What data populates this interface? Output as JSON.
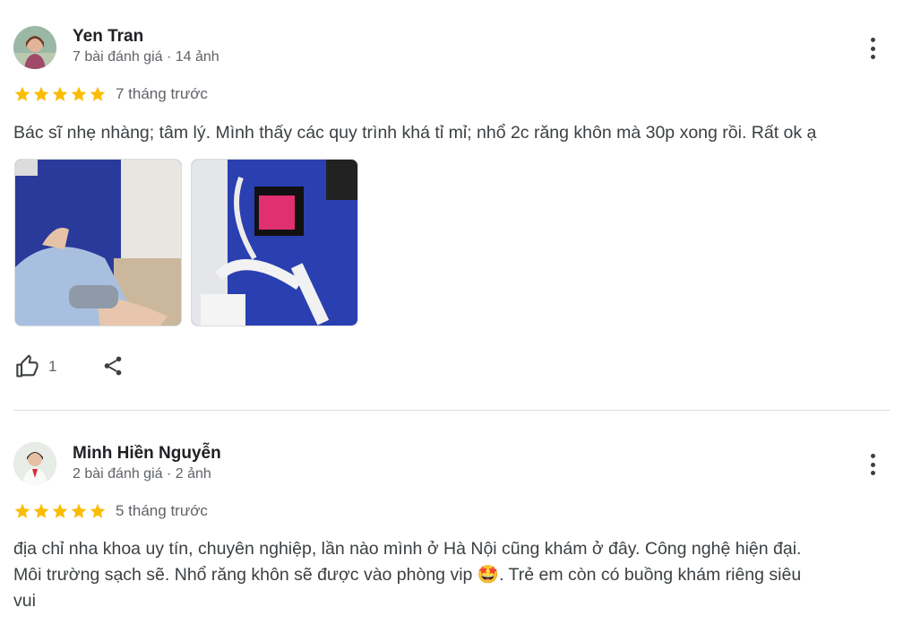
{
  "reviews": [
    {
      "author": "Yen Tran",
      "meta": "7 bài đánh giá · 14 ảnh",
      "rating": 5,
      "time": "7 tháng trước",
      "text": "Bác sĩ nhẹ nhàng; tâm lý. Mình thấy các quy trình khá tỉ mỉ; nhổ 2c răng khôn mà 30p xong rồi. Rất ok ạ",
      "likes": "1"
    },
    {
      "author": "Minh Hiền Nguyễn",
      "meta": "2 bài đánh giá · 2 ảnh",
      "rating": 5,
      "time": "5 tháng trước",
      "text_line1": "địa chỉ nha khoa uy tín, chuyên nghiệp, lần nào mình ở Hà Nội cũng khám ở đây. Công nghệ hiện đại.",
      "text_line2a": "Môi trường sạch sẽ. Nhổ răng khôn sẽ được vào phòng vip ",
      "text_emoji": "🤩",
      "text_line2b": ". Trẻ em còn có buồng khám riêng siêu",
      "text_line3": "vui"
    }
  ],
  "colors": {
    "star": "#fbbc04",
    "text": "#3c4043",
    "muted": "#5f6368",
    "divider": "#dadce0"
  },
  "icons": [
    "more-vert-icon",
    "star-icon",
    "thumb-up-icon",
    "share-icon"
  ]
}
